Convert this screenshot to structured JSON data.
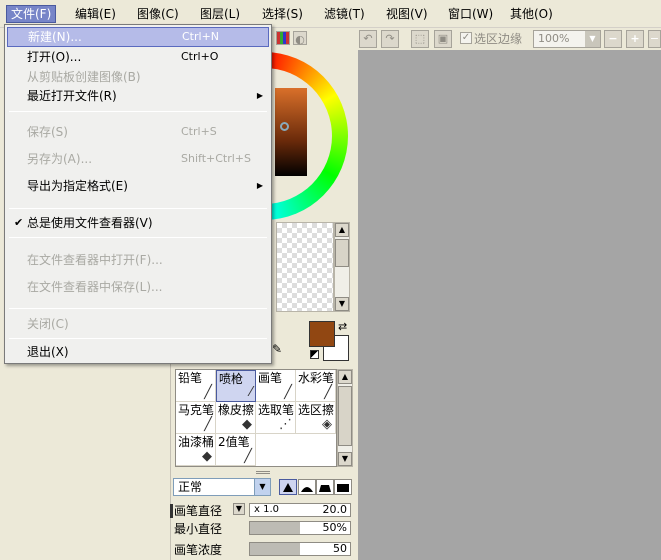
{
  "menubar": {
    "items": [
      {
        "label": "文件(F)"
      },
      {
        "label": "编辑(E)"
      },
      {
        "label": "图像(C)"
      },
      {
        "label": "图层(L)"
      },
      {
        "label": "选择(S)"
      },
      {
        "label": "滤镜(T)"
      },
      {
        "label": "视图(V)"
      },
      {
        "label": "窗口(W)"
      },
      {
        "label": "其他(O)"
      }
    ]
  },
  "file_menu": {
    "items": [
      {
        "label": "新建(N)...",
        "shortcut": "Ctrl+N"
      },
      {
        "label": "打开(O)...",
        "shortcut": "Ctrl+O"
      },
      {
        "label": "从剪贴板创建图像(B)"
      },
      {
        "label": "最近打开文件(R)"
      },
      {
        "label": "保存(S)",
        "shortcut": "Ctrl+S"
      },
      {
        "label": "另存为(A)...",
        "shortcut": "Shift+Ctrl+S"
      },
      {
        "label": "导出为指定格式(E)"
      },
      {
        "label": "总是使用文件查看器(V)"
      },
      {
        "label": "在文件查看器中打开(F)..."
      },
      {
        "label": "在文件查看器中保存(L)..."
      },
      {
        "label": "关闭(C)"
      },
      {
        "label": "退出(X)"
      }
    ]
  },
  "toolbar": {
    "selection_border_label": "选区边缘",
    "zoom_value": "100%"
  },
  "colors": {
    "foreground": "#914712",
    "background": "#ffffff",
    "menu_highlight": "#b5bbe8",
    "canvas": "#a5a5a5"
  },
  "tools": [
    {
      "label": "铅笔",
      "icon": "pencil-icon"
    },
    {
      "label": "喷枪",
      "icon": "airbrush-icon"
    },
    {
      "label": "画笔",
      "icon": "brush-icon"
    },
    {
      "label": "水彩笔",
      "icon": "watercolor-icon"
    },
    {
      "label": "马克笔",
      "icon": "marker-icon"
    },
    {
      "label": "橡皮擦",
      "icon": "eraser-icon"
    },
    {
      "label": "选取笔",
      "icon": "select-pen-icon"
    },
    {
      "label": "选区擦",
      "icon": "select-eraser-icon"
    },
    {
      "label": "油漆桶",
      "icon": "bucket-icon"
    },
    {
      "label": "2值笔",
      "icon": "binary-pen-icon"
    }
  ],
  "brush": {
    "blend_mode": "正常",
    "size_label": "画笔直径",
    "size_multiplier": "x 1.0",
    "size_value": "20.0",
    "min_size_label": "最小直径",
    "min_size_value": "50%",
    "min_size_fraction": 0.5,
    "density_label": "画笔浓度",
    "density_value": "50",
    "density_fraction": 0.5
  }
}
